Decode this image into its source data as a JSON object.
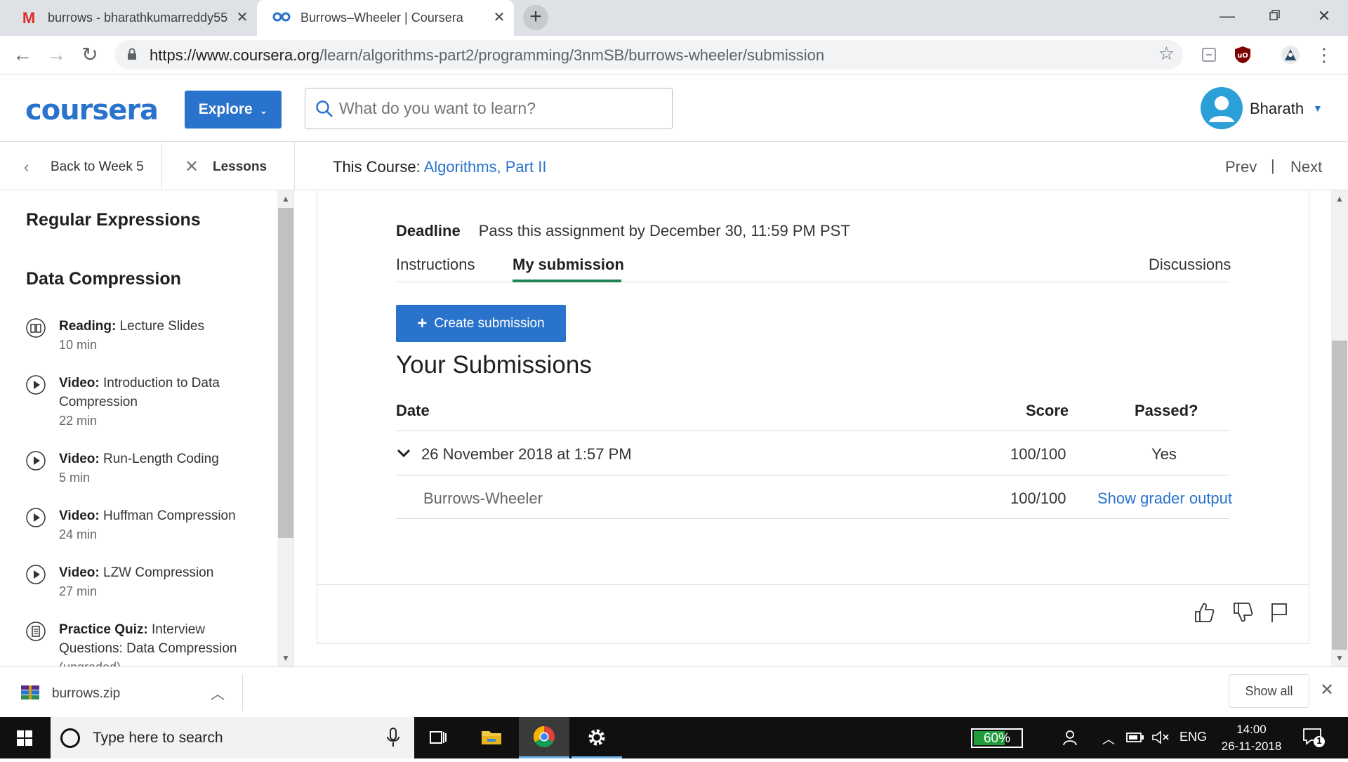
{
  "browser": {
    "tabs": [
      {
        "title": "burrows - bharathkumarreddy55",
        "icon": "gmail-icon",
        "active": false
      },
      {
        "title": "Burrows–Wheeler | Coursera",
        "icon": "coursera-icon",
        "active": true
      }
    ],
    "url_host": "https://www.coursera.org",
    "url_path": "/learn/algorithms-part2/programming/3nmSB/burrows-wheeler/submission"
  },
  "header": {
    "logo": "coursera",
    "explore_label": "Explore",
    "search_placeholder": "What do you want to learn?",
    "user_name": "Bharath"
  },
  "subnav": {
    "back_label": "Back to Week 5",
    "lessons_label": "Lessons",
    "course_prefix": "This Course: ",
    "course_name": "Algorithms, Part II",
    "prev_label": "Prev",
    "separator": "|",
    "next_label": "Next"
  },
  "sidebar": {
    "sections": [
      "Regular Expressions",
      "Data Compression"
    ],
    "items": [
      {
        "type": "Reading:",
        "title": " Lecture Slides",
        "duration": "10 min",
        "icon": "book-icon"
      },
      {
        "type": "Video:",
        "title": " Introduction to Data Compression",
        "duration": "22 min",
        "icon": "play-icon"
      },
      {
        "type": "Video:",
        "title": " Run-Length Coding",
        "duration": "5 min",
        "icon": "play-icon"
      },
      {
        "type": "Video:",
        "title": " Huffman Compression",
        "duration": "24 min",
        "icon": "play-icon"
      },
      {
        "type": "Video:",
        "title": " LZW Compression",
        "duration": "27 min",
        "icon": "play-icon"
      },
      {
        "type": "Practice Quiz:",
        "title": " Interview Questions: Data Compression",
        "duration": "(ungraded)",
        "icon": "quiz-icon"
      }
    ]
  },
  "assignment": {
    "deadline_label": "Deadline",
    "deadline_text": "Pass this assignment by December 30, 11:59 PM PST",
    "tabs": [
      "Instructions",
      "My submission",
      "Discussions"
    ],
    "active_tab": "My submission",
    "create_button": "Create submission",
    "submissions_title": "Your Submissions",
    "columns": [
      "Date",
      "Score",
      "Passed?"
    ],
    "submission": {
      "date": "26 November 2018 at 1:57 PM",
      "score": "100/100",
      "passed": "Yes",
      "part_name": "Burrows-Wheeler",
      "part_score": "100/100",
      "grader_link": "Show grader output"
    }
  },
  "download_bar": {
    "file_name": "burrows.zip",
    "show_all_label": "Show all"
  },
  "taskbar": {
    "search_placeholder": "Type here to search",
    "battery": "60%",
    "language": "ENG",
    "time": "14:00",
    "date": "26-11-2018",
    "notification_count": "1"
  },
  "colors": {
    "brand_blue": "#2a73cc",
    "active_tab_green": "#1f8354",
    "battery_green": "#1f9d3a"
  }
}
